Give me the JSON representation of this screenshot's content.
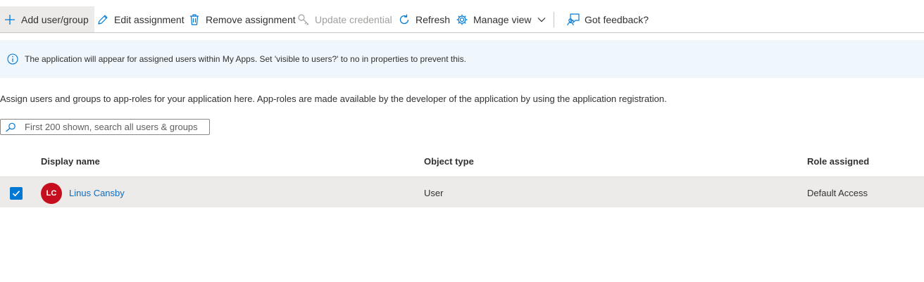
{
  "toolbar": {
    "add_label": "Add user/group",
    "edit_label": "Edit assignment",
    "remove_label": "Remove assignment",
    "update_label": "Update credential",
    "refresh_label": "Refresh",
    "manage_view_label": "Manage view",
    "feedback_label": "Got feedback?"
  },
  "banner": {
    "message": "The application will appear for assigned users within My Apps. Set 'visible to users?' to no in properties to prevent this."
  },
  "description": "Assign users and groups to app-roles for your application here. App-roles are made available by the developer of the application by using the application registration.",
  "search": {
    "placeholder": "First 200 shown, search all users & groups"
  },
  "table": {
    "headers": [
      "Display name",
      "Object type",
      "Role assigned"
    ],
    "rows": [
      {
        "initials": "LC",
        "display_name": "Linus Cansby",
        "object_type": "User",
        "role": "Default Access",
        "selected": true
      }
    ]
  },
  "colors": {
    "accent": "#0078d4",
    "avatar": "#c50f1f",
    "banner_bg": "#eff6fc",
    "selected_row_bg": "#edebe9",
    "link": "#0f6cbd"
  }
}
